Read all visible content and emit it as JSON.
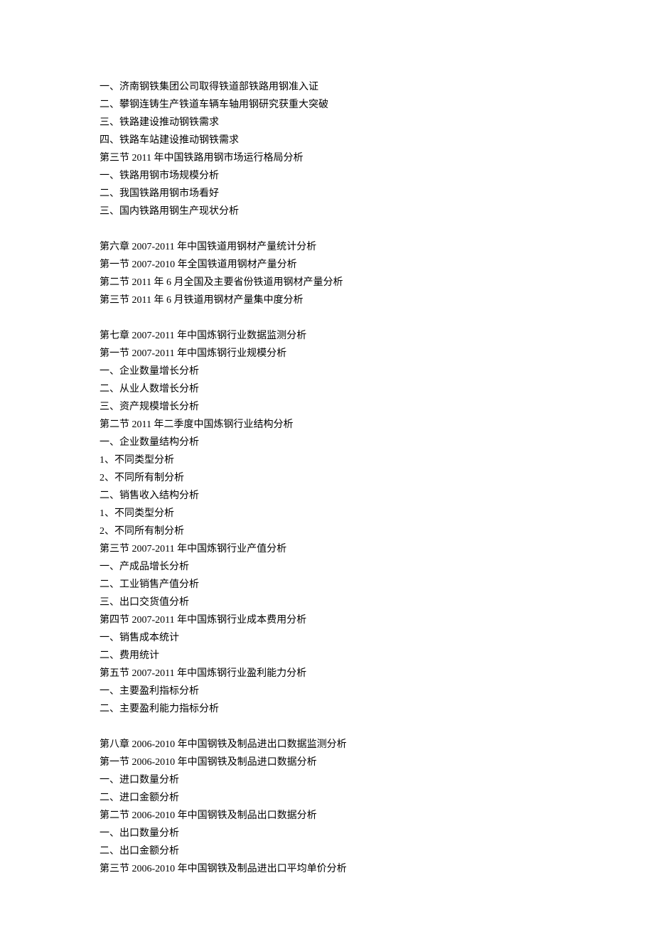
{
  "blocks": [
    [
      "一、济南钢铁集团公司取得铁道部铁路用钢准入证",
      "二、攀钢连铸生产铁道车辆车轴用钢研究获重大突破",
      "三、铁路建设推动钢铁需求",
      "四、铁路车站建设推动钢铁需求",
      "第三节 2011 年中国铁路用钢市场运行格局分析",
      "一、铁路用钢市场规模分析",
      "二、我国铁路用钢市场看好",
      "三、国内铁路用钢生产现状分析"
    ],
    [
      "第六章 2007-2011 年中国铁道用钢材产量统计分析",
      "第一节 2007-2010 年全国铁道用钢材产量分析",
      "第二节 2011 年 6 月全国及主要省份铁道用钢材产量分析",
      "第三节 2011 年 6 月铁道用钢材产量集中度分析"
    ],
    [
      "第七章 2007-2011 年中国炼钢行业数据监测分析",
      "第一节 2007-2011 年中国炼钢行业规模分析",
      "一、企业数量增长分析",
      "二、从业人数增长分析",
      "三、资产规模增长分析",
      "第二节 2011 年二季度中国炼钢行业结构分析",
      "一、企业数量结构分析",
      "1、不同类型分析",
      "2、不同所有制分析",
      "二、销售收入结构分析",
      "1、不同类型分析",
      "2、不同所有制分析",
      "第三节 2007-2011 年中国炼钢行业产值分析",
      "一、产成品增长分析",
      "二、工业销售产值分析",
      "三、出口交货值分析",
      "第四节 2007-2011 年中国炼钢行业成本费用分析",
      "一、销售成本统计",
      "二、费用统计",
      "第五节 2007-2011 年中国炼钢行业盈利能力分析",
      "一、主要盈利指标分析",
      "二、主要盈利能力指标分析"
    ],
    [
      "第八章 2006-2010 年中国钢铁及制品进出口数据监测分析",
      "第一节 2006-2010 年中国钢铁及制品进口数据分析",
      "一、进口数量分析",
      "二、进口金额分析",
      "第二节 2006-2010 年中国钢铁及制品出口数据分析",
      "一、出口数量分析",
      "二、出口金额分析",
      "第三节 2006-2010 年中国钢铁及制品进出口平均单价分析"
    ]
  ]
}
